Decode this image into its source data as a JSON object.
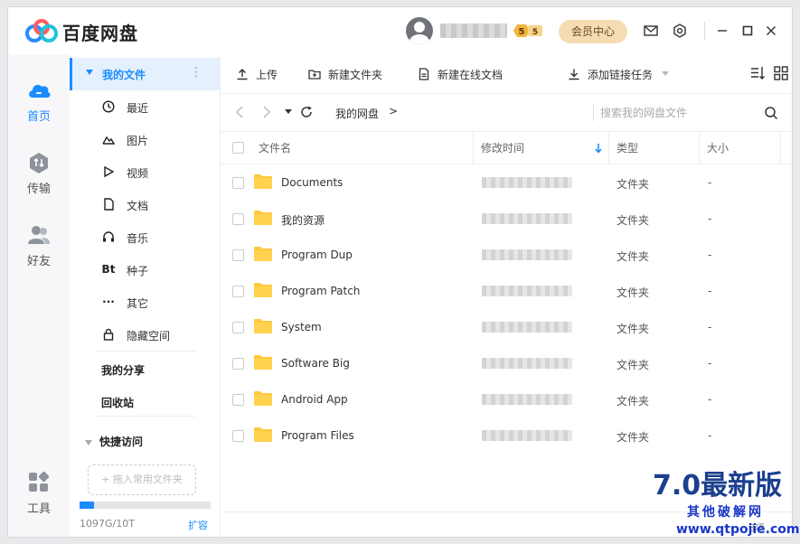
{
  "app": {
    "title": "百度网盘"
  },
  "header": {
    "level_badge": "5",
    "level_badge2": "5",
    "vip_button": "会员中心"
  },
  "leftnav": [
    {
      "label": "首页",
      "icon": "cloud-icon"
    },
    {
      "label": "传输",
      "icon": "transfer-icon"
    },
    {
      "label": "好友",
      "icon": "friends-icon"
    },
    {
      "label": "工具",
      "icon": "tools-icon"
    }
  ],
  "sidebar": {
    "my_files": "我的文件",
    "items": [
      {
        "label": "最近",
        "icon": "clock-icon"
      },
      {
        "label": "图片",
        "icon": "image-icon"
      },
      {
        "label": "视频",
        "icon": "play-icon"
      },
      {
        "label": "文档",
        "icon": "document-icon"
      },
      {
        "label": "音乐",
        "icon": "headphones-icon"
      },
      {
        "label": "种子",
        "icon": "torrent-icon",
        "glyph": "Bt"
      },
      {
        "label": "其它",
        "icon": "more-icon",
        "glyph": "···"
      },
      {
        "label": "隐藏空间",
        "icon": "lock-icon"
      }
    ],
    "my_share": "我的分享",
    "recycle": "回收站",
    "quick_access": "快捷访问",
    "drop_hint": "+ 拖入常用文件夹",
    "quota_text": "1097G/10T",
    "quota_fraction": 0.107,
    "expand": "扩容"
  },
  "toolbar": {
    "upload": "上传",
    "new_folder": "新建文件夹",
    "new_doc": "新建在线文档",
    "add_link": "添加链接任务"
  },
  "pathbar": {
    "crumb": "我的网盘",
    "crumb_sep": ">",
    "search_placeholder": "搜索我的网盘文件"
  },
  "table": {
    "headers": {
      "name": "文件名",
      "mtime": "修改时间",
      "type": "类型",
      "size": "大小"
    },
    "rows": [
      {
        "name": "Documents",
        "type": "文件夹",
        "size": "-"
      },
      {
        "name": "我的资源",
        "type": "文件夹",
        "size": "-"
      },
      {
        "name": "Program Dup",
        "type": "文件夹",
        "size": "-"
      },
      {
        "name": "Program Patch",
        "type": "文件夹",
        "size": "-"
      },
      {
        "name": "System",
        "type": "文件夹",
        "size": "-"
      },
      {
        "name": "Software Big",
        "type": "文件夹",
        "size": "-"
      },
      {
        "name": "Android App",
        "type": "文件夹",
        "size": "-"
      },
      {
        "name": "Program Files",
        "type": "文件夹",
        "size": "-"
      }
    ]
  },
  "footer": {
    "item_count": "8项"
  },
  "watermark": {
    "big": "7.0最新版",
    "sub": "其他破解网",
    "url": "www.qtpojie.com"
  },
  "colors": {
    "accent": "#1a8cff",
    "folder": "#ffc83d",
    "vip": "#f6dcb3"
  }
}
